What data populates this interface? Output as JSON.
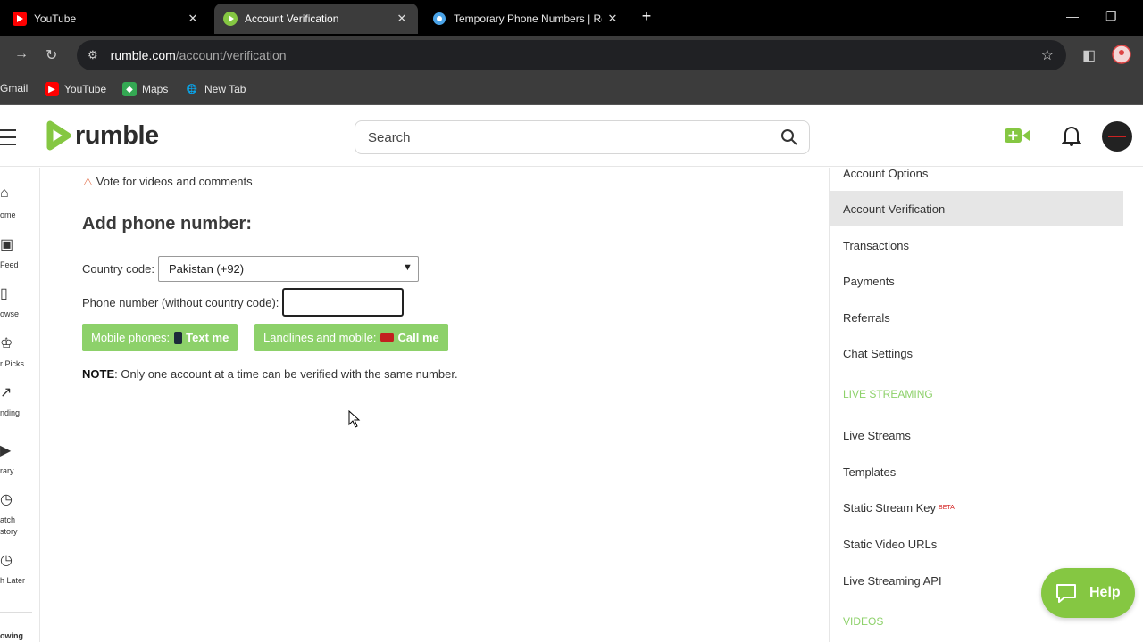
{
  "browser": {
    "tabs": [
      {
        "title": "YouTube",
        "icon": "youtube-icon"
      },
      {
        "title": "Account Verification",
        "icon": "rumble-icon",
        "active": true
      },
      {
        "title": "Temporary Phone Numbers | Re",
        "icon": "chat-icon"
      }
    ],
    "url_host": "rumble.com",
    "url_path": "/account/verification",
    "bookmarks": [
      "Gmail",
      "YouTube",
      "Maps",
      "New Tab"
    ]
  },
  "header": {
    "logo_text": "rumble",
    "search_placeholder": "Search"
  },
  "rail": [
    "ome",
    "Feed",
    "owse",
    "r Picks",
    "nding",
    "rary",
    "atch",
    "story",
    "h Later",
    "owing"
  ],
  "main": {
    "vote_text": "Vote for videos and comments",
    "heading": "Add phone number:",
    "country_label": "Country code:",
    "country_value": "Pakistan (+92)",
    "phone_label": "Phone number (without country code):",
    "text_btn_prefix": "Mobile phones:",
    "text_btn_action": "Text me",
    "call_btn_prefix": "Landlines and mobile:",
    "call_btn_action": "Call me",
    "note_label": "NOTE",
    "note_text": ": Only one account at a time can be verified with the same number."
  },
  "sidebar": {
    "items": [
      "Account Options",
      "Account Verification",
      "Transactions",
      "Payments",
      "Referrals",
      "Chat Settings"
    ],
    "section_live": "LIVE STREAMING",
    "live_items": [
      "Live Streams",
      "Templates",
      "Static Stream Key",
      "Static Video URLs",
      "Live Streaming API"
    ],
    "beta_label": "BETA",
    "section_videos": "VIDEOS"
  },
  "help_label": "Help",
  "colors": {
    "brand_green": "#85c742",
    "button_green": "#8dd16a",
    "active_row": "#e6e6e6"
  }
}
